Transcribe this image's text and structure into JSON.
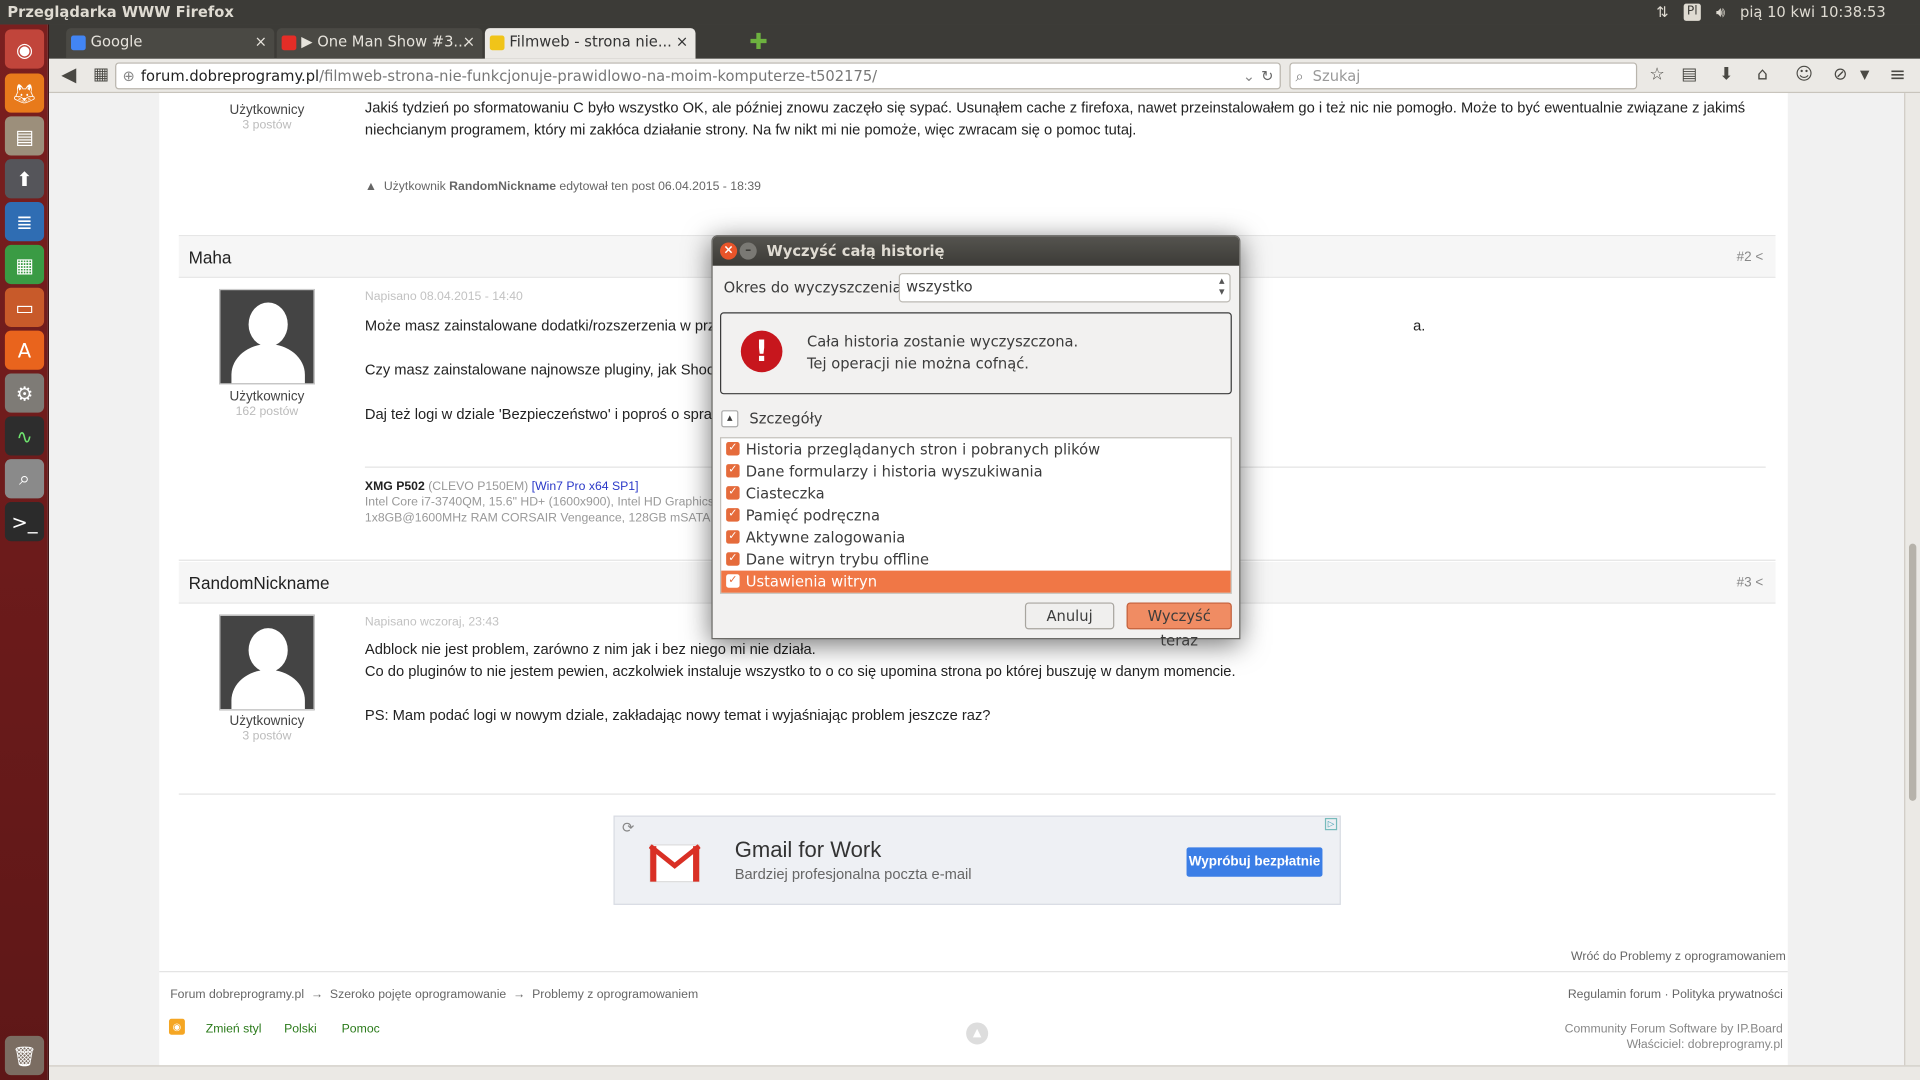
{
  "system": {
    "window_title": "Przeglądarka WWW Firefox",
    "keyboard_layout": "Pl",
    "clock": "pią 10 kwi 10:38:53"
  },
  "tabs": [
    {
      "label": "Google",
      "close": "×"
    },
    {
      "label": "▶ One Man Show #3...",
      "close": "×"
    },
    {
      "label": "Filmweb - strona nie...",
      "close": "×"
    }
  ],
  "new_tab": "✚",
  "nav": {
    "url_domain": "forum.dobreprogramy.pl",
    "url_path": "/filmweb-strona-nie-funkcjonuje-prawidlowo-na-moim-komputerze-t502175/",
    "search_placeholder": "Szukaj"
  },
  "posts": {
    "first": {
      "role": "Użytkownicy",
      "count": "3 postów",
      "line1": "Jakiś tydzień po sformatowaniu C było wszystko OK, ale później znowu zaczęło się sypać. Usunąłem cache z firefoxa, nawet przeinstalowałem go i też nic nie pomogło. Może to być ewentualnie związane z jakimś",
      "line2": "niechcianym programem, który mi zakłóca działanie strony. Na fw nikt mi nie pomoże, więc zwracam się o pomoc tutaj.",
      "edit_prefix": "Użytkownik",
      "edit_user": "RandomNickname",
      "edit_suffix": "edytował ten post 06.04.2015 - 18:39"
    },
    "maha": {
      "author": "Maha",
      "num": "#2",
      "date": "Napisano 08.04.2015 - 14:40",
      "role": "Użytkownicy",
      "count": "162 postów",
      "line1": "Może masz zainstalowane dodatki/rozszerzenia w prze",
      "line1_end": "a.",
      "line2": "Czy masz zainstalowane najnowsze pluginy, jak Shock",
      "line3": "Daj też logi w dziale 'Bezpieczeństwo' i poproś o spraw",
      "sig_title": "XMG P502",
      "sig_model": "(CLEVO P150EM)",
      "sig_os": "[Win7 Pro x64 SP1]",
      "sig_line2": "Intel Core i7-3740QM, 15.6\" HD+ (1600x900), Intel HD Graphics 4",
      "sig_line3": "1x8GB@1600MHz RAM CORSAIR Vengeance, 128GB mSATA C"
    },
    "random": {
      "author": "RandomNickname",
      "num": "#3",
      "date": "Napisano wczoraj, 23:43",
      "role": "Użytkownicy",
      "count": "3 postów",
      "line1": "Adblock nie jest problem, zarówno z nim jak i bez niego mi nie działa.",
      "line2": "Co do pluginów to nie jestem pewien, aczkolwiek instaluje wszystko to o co się upomina strona po której buszuję w danym momencie.",
      "line3": "PS: Mam podać logi w nowym dziale, zakładając nowy temat i wyjaśniając problem jeszcze raz?"
    }
  },
  "ad": {
    "title": "Gmail for Work",
    "subtitle": "Bardziej profesjonalna poczta e-mail",
    "button": "Wypróbuj bezpłatnie"
  },
  "footer": {
    "back": "Wróć do Problemy z oprogramowaniem",
    "crumb1": "Forum dobreprogramy.pl",
    "crumb2": "Szeroko pojęte oprogramowanie",
    "crumb3": "Problemy z oprogramowaniem",
    "arrow": "→",
    "rules": "Regulamin forum · Polityka prywatności",
    "style": "Zmień styl",
    "lang": "Polski",
    "help": "Pomoc",
    "software": "Community Forum Software by IP.Board",
    "owner": "Właściciel: dobreprogramy.pl"
  },
  "dialog": {
    "title": "Wyczyść całą historię",
    "period_label": "Okres do wyczyszczenia:",
    "period_value": "wszystko",
    "warn1": "Cała historia zostanie wyczyszczona.",
    "warn2": "Tej operacji nie można cofnąć.",
    "details": "Szczegóły",
    "items": [
      "Historia przeglądanych stron i pobranych plików",
      "Dane formularzy i historia wyszukiwania",
      "Ciasteczka",
      "Pamięć podręczna",
      "Aktywne zalogowania",
      "Dane witryn trybu offline",
      "Ustawienia witryn"
    ],
    "selected_index": 6,
    "cancel": "Anuluj",
    "confirm": "Wyczyść teraz"
  },
  "colors": {
    "launcher": "#6b1b1b",
    "accent": "#f07746",
    "topbar": "#3c3b37"
  }
}
